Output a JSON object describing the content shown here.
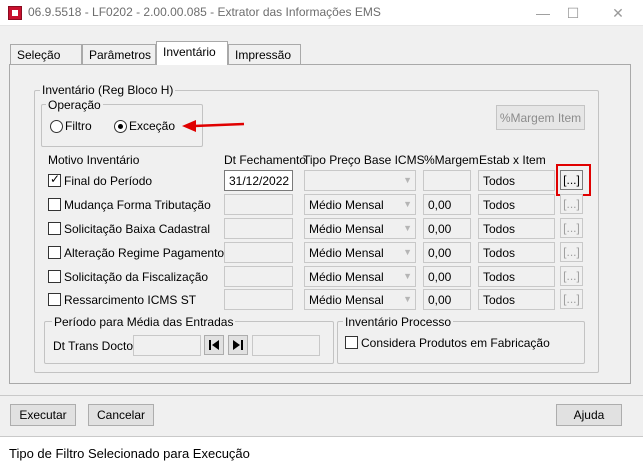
{
  "window": {
    "title": "06.9.5518 - LF0202 - 2.00.00.085 - Extrator das Informações EMS",
    "minimize_glyph": "—",
    "maximize_glyph": "☐",
    "close_glyph": "✕"
  },
  "tabs": [
    {
      "label": "Seleção",
      "active": false
    },
    {
      "label": "Parâmetros",
      "active": false
    },
    {
      "label": "Inventário",
      "active": true
    },
    {
      "label": "Impressão",
      "active": false
    }
  ],
  "inventario": {
    "group_title": "Inventário (Reg Bloco H)",
    "operacao": {
      "title": "Operação",
      "options": [
        {
          "label": "Filtro",
          "selected": false
        },
        {
          "label": "Exceção",
          "selected": true
        }
      ]
    },
    "margem_item_button": "%Margem Item",
    "columns": {
      "motivo": "Motivo Inventário",
      "dt_fechamento": "Dt Fechamento",
      "tipo_preco": "Tipo Preço Base ICMS",
      "margem": "%Margem",
      "estab_item": "Estab x Item"
    },
    "rows": [
      {
        "label": "Final do Período",
        "checked": true,
        "dt_fechamento": "31/12/2022",
        "tipo_preco": "",
        "margem": "",
        "estab_item": "Todos",
        "button": "[...]"
      },
      {
        "label": "Mudança Forma Tributação",
        "checked": false,
        "dt_fechamento": "",
        "tipo_preco": "Médio Mensal",
        "margem": "0,00",
        "estab_item": "Todos",
        "button": "[...]"
      },
      {
        "label": "Solicitação Baixa Cadastral",
        "checked": false,
        "dt_fechamento": "",
        "tipo_preco": "Médio Mensal",
        "margem": "0,00",
        "estab_item": "Todos",
        "button": "[...]"
      },
      {
        "label": "Alteração Regime Pagamento",
        "checked": false,
        "dt_fechamento": "",
        "tipo_preco": "Médio Mensal",
        "margem": "0,00",
        "estab_item": "Todos",
        "button": "[...]"
      },
      {
        "label": "Solicitação da Fiscalização",
        "checked": false,
        "dt_fechamento": "",
        "tipo_preco": "Médio Mensal",
        "margem": "0,00",
        "estab_item": "Todos",
        "button": "[...]"
      },
      {
        "label": "Ressarcimento ICMS ST",
        "checked": false,
        "dt_fechamento": "",
        "tipo_preco": "Médio Mensal",
        "margem": "0,00",
        "estab_item": "Todos",
        "button": "[...]"
      }
    ],
    "periodo": {
      "title": "Período para Média das Entradas",
      "dt_label": "Dt Trans Docto:"
    },
    "processo": {
      "title": "Inventário Processo",
      "checkbox_label": "Considera Produtos em Fabricação"
    }
  },
  "footer": {
    "executar": "Executar",
    "cancelar": "Cancelar",
    "ajuda": "Ajuda"
  },
  "status_text": "Tipo de Filtro Selecionado para Execução",
  "colors": {
    "annotation_red": "#e00000"
  }
}
